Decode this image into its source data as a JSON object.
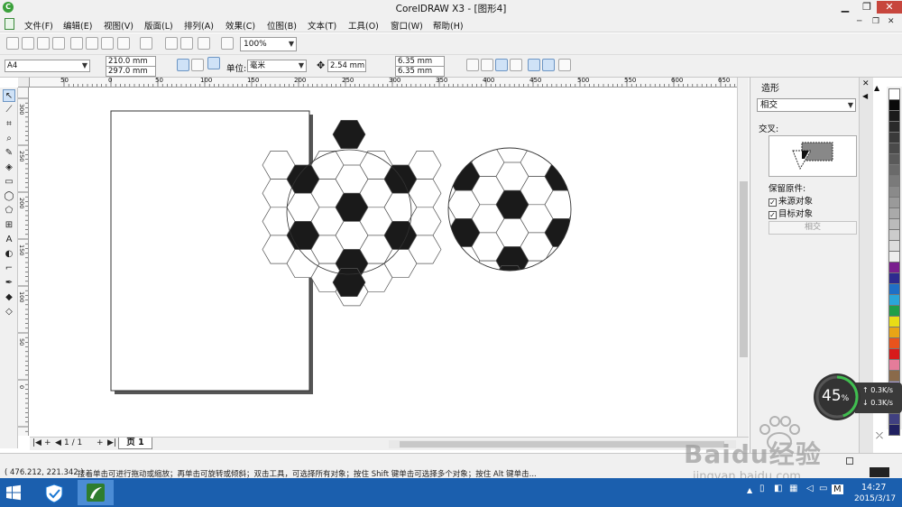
{
  "window": {
    "title": "CorelDRAW X3 - [图形4]",
    "icon": "coreldraw-icon",
    "controls": {
      "minimize": "▁",
      "maximize": "❐",
      "close": "✕"
    }
  },
  "menu": {
    "items": [
      "文件(F)",
      "编辑(E)",
      "视图(V)",
      "版面(L)",
      "排列(A)",
      "效果(C)",
      "位图(B)",
      "文本(T)",
      "工具(O)",
      "窗口(W)",
      "帮助(H)"
    ],
    "doc_controls": [
      "─",
      "❐",
      "✕"
    ]
  },
  "standard_toolbar": {
    "zoom_value": "100%"
  },
  "property_bar": {
    "page_size": "A4",
    "page_width": "210.0 mm",
    "page_height": "297.0 mm",
    "units_label": "单位:",
    "units_value": "毫米",
    "nudge_value": "2.54 mm",
    "dup_x": "6.35 mm",
    "dup_y": "6.35 mm"
  },
  "rulers": {
    "horizontal_ticks": [
      "50",
      "0",
      "50",
      "100",
      "150",
      "200",
      "250",
      "300",
      "350",
      "400",
      "450",
      "500",
      "550",
      "600",
      "650"
    ],
    "vertical_ticks": [
      "300",
      "250",
      "200",
      "150",
      "100",
      "50",
      "0"
    ]
  },
  "page_nav": {
    "first": "|◀",
    "prev": "◀",
    "counter": "1 / 1",
    "next": "▶",
    "last": "▶|",
    "add": "+",
    "tab_label": "页 1"
  },
  "docker": {
    "title": "造形",
    "mode_value": "相交",
    "section_label": "交叉:",
    "keep_label": "保留原件:",
    "source_label": "来源对象",
    "target_label": "目标对象",
    "source_checked": true,
    "target_checked": true,
    "apply_label": "相交"
  },
  "palette": {
    "colors": [
      "#ffffff",
      "#0a0a0a",
      "#1a1a1a",
      "#2a2a2a",
      "#3a3a3a",
      "#4a4a4a",
      "#5a5a5a",
      "#6a6a6a",
      "#7a7a7a",
      "#8a8a8a",
      "#9a9a9a",
      "#aaaaaa",
      "#bbbbbb",
      "#cccccc",
      "#dddddd",
      "#eeeeee",
      "#7a1f8e",
      "#2e2a8f",
      "#1f6fc6",
      "#2aa5d8",
      "#1f9e48",
      "#e8dd16",
      "#e8a516",
      "#e8531c",
      "#d81b1b",
      "#e57c9a",
      "#8a6a4a",
      "#b0a0d0",
      "#9090c0",
      "#6060a0",
      "#404080",
      "#202060"
    ]
  },
  "status": {
    "coords": "( 476.212, 221.342 )",
    "message": "接着单击可进行拖动或缩放；再单击可旋转或倾斜；双击工具，可选择所有对象；按住 Shift 键单击可选择多个对象；按住 Alt 键单击..."
  },
  "net_widget": {
    "percent": "45",
    "percent_sign": "%",
    "upload": "0.3K/s",
    "download": "0.3K/s"
  },
  "watermark": {
    "brand": "Baidu经验",
    "url": "jingyan.baidu.com"
  },
  "taskbar": {
    "time": "14:27",
    "date": "2015/3/17",
    "input_indicator": "M"
  }
}
